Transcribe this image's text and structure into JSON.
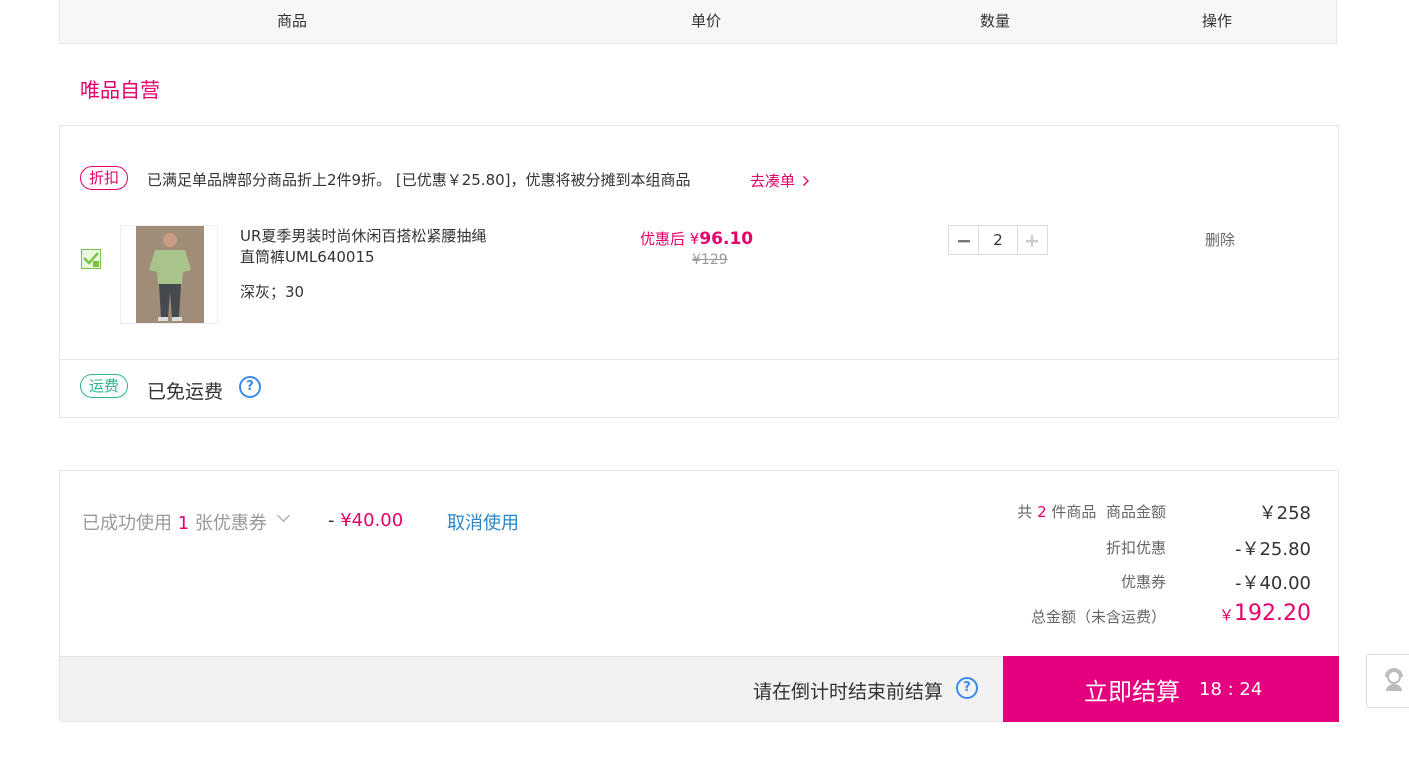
{
  "table_header": {
    "product": "商品",
    "unit_price": "单价",
    "quantity": "数量",
    "action": "操作"
  },
  "shop": {
    "title": "唯品自营"
  },
  "promotion": {
    "tag": "折扣",
    "text": "已满足单品牌部分商品折上2件9折。 [已优惠￥25.80]，优惠将被分摊到本组商品",
    "link": "去凑单"
  },
  "product": {
    "checked": true,
    "name": "UR夏季男装时尚休闲百搭松紧腰抽绳直筒裤UML640015",
    "spec": "深灰；30",
    "price_after_label": "优惠后",
    "price_currency": "¥",
    "price_after": "96.10",
    "price_original": "¥129",
    "quantity": "2",
    "delete": "删除"
  },
  "shipping": {
    "tag": "运费",
    "text": "已免运费"
  },
  "coupon": {
    "used_prefix": "已成功使用",
    "used_count": "1",
    "used_suffix": "张优惠券",
    "dash": "- ",
    "amount": "¥40.00",
    "cancel": "取消使用"
  },
  "summary": {
    "count_prefix": "共",
    "count": "2",
    "count_suffix": "件商品",
    "goods_label": "商品金额",
    "goods_value": "￥258",
    "discount_label": "折扣优惠",
    "discount_value": "-￥25.80",
    "coupon_label": "优惠券",
    "coupon_value": "-￥40.00",
    "total_label": "总金额（未含运费）",
    "total_currency": "￥",
    "total_value": "192.20"
  },
  "checkout": {
    "countdown_text": "请在倒计时结束前结算",
    "button": "立即结算",
    "timer": "18 : 24"
  },
  "colors": {
    "brand": "#e5006b",
    "checkout": "#e5007f",
    "link": "#2a86c6",
    "shipping": "#2db58c"
  }
}
